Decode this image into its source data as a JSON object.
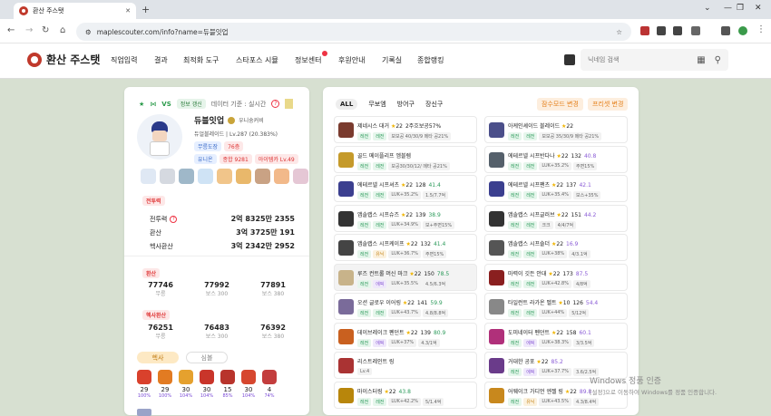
{
  "browser": {
    "tab_title": "환산 주스탯",
    "url": "maplescouter.com/info?name=듀블잇업"
  },
  "site": {
    "logo": "환산 주스탯",
    "menu": [
      "직업입력",
      "결과",
      "최적화 도구",
      "스타포스 시뮬",
      "정보센터",
      "후원안내",
      "기록실",
      "종합랭킹"
    ],
    "search_placeholder": "닉네임 검색"
  },
  "profile": {
    "vs": "VS",
    "update_btn": "정보 갱신",
    "data_basis": "데이터 기준 : 실시간",
    "name": "듀블잇업",
    "guild": "우니숭커비",
    "job_line": "듀얼블레이드 | Lv.287 (20.383%)",
    "tags1": [
      "무릉도장",
      "76층"
    ],
    "tags2": [
      "유니온",
      "종합 9281",
      "아이템카 Lv.49"
    ]
  },
  "combat": {
    "header": "전투력",
    "rows": [
      {
        "label": "전투력",
        "value": "2억 8325만 2355"
      },
      {
        "label": "환산",
        "value": "3억 3725만 191"
      },
      {
        "label": "헥사환산",
        "value": "3억 2342만 2952"
      }
    ]
  },
  "hwansan": {
    "header": "환산",
    "cols": [
      {
        "v": "77746",
        "l": "무릉"
      },
      {
        "v": "77992",
        "l": "보스 300"
      },
      {
        "v": "77891",
        "l": "보스 380"
      }
    ]
  },
  "hexa": {
    "header": "헥사환산",
    "cols": [
      {
        "v": "76251",
        "l": "무릉"
      },
      {
        "v": "76483",
        "l": "보스 300"
      },
      {
        "v": "76392",
        "l": "보스 380"
      }
    ]
  },
  "skill_tabs": [
    "헥사",
    "심볼"
  ],
  "hexa_skills": [
    {
      "lv": "29",
      "pct": "100%"
    },
    {
      "lv": "29",
      "pct": "100%"
    },
    {
      "lv": "30",
      "pct": "104%"
    },
    {
      "lv": "30",
      "pct": "104%"
    },
    {
      "lv": "15",
      "pct": "85%"
    },
    {
      "lv": "30",
      "pct": "104%"
    },
    {
      "lv": "4",
      "pct": "74%"
    }
  ],
  "equip": {
    "tabs": [
      "ALL",
      "무보엠",
      "방어구",
      "장신구"
    ],
    "btn_potential": "잠수모드 변경",
    "btn_preset": "프리셋 변경",
    "items": [
      {
        "name": "제네시스 대거",
        "star": "22",
        "extra": "2주흐보공57%",
        "subs": [
          "레전",
          "레전",
          "보보공 40/30/9 메타 공21%"
        ],
        "color": "#7a3b2e"
      },
      {
        "name": "아케인셰이드 블레이드",
        "star": "22",
        "extra": "",
        "subs": [
          "레전",
          "레전",
          "보보공 35/30/9 메타 공21%"
        ],
        "color": "#4b4f8a"
      },
      {
        "name": "골드 메이플리프 엠블렘",
        "star": "",
        "extra": "",
        "subs": [
          "레전",
          "레전",
          "보공30/30/12/ 메타 공21%"
        ],
        "color": "#c59a2a"
      },
      {
        "name": "에테르넬 시프반다나",
        "star": "22",
        "extra": "132",
        "num": "40.8",
        "subs": [
          "레전",
          "레전",
          "LUK+35.2%",
          "주면15%"
        ],
        "color": "#55606b"
      },
      {
        "name": "에테르넬 시프셔츠",
        "star": "22",
        "extra": "128",
        "num": "41.4",
        "subs": [
          "레전",
          "레전",
          "LUK+35.2%",
          "1.5/7.7억"
        ],
        "color": "#3b3f8f"
      },
      {
        "name": "에테르넬 시프팬츠",
        "star": "22",
        "extra": "137",
        "num": "42.1",
        "subs": [
          "레전",
          "레전",
          "LUK+35.4%",
          "보스+35%"
        ],
        "color": "#3b3f8f"
      },
      {
        "name": "앱솔랩스 시프슈즈",
        "star": "22",
        "extra": "139",
        "num": "38.9",
        "subs": [
          "레전",
          "레전",
          "LUK+34.9%",
          "보+주면15%"
        ],
        "color": "#333"
      },
      {
        "name": "앱솔랩스 시프글러브",
        "star": "22",
        "extra": "151",
        "num": "44.2",
        "subs": [
          "레전",
          "레전",
          "크크",
          "4/4/7억"
        ],
        "color": "#333"
      },
      {
        "name": "앱솔랩스 시프케이프",
        "star": "22",
        "extra": "132",
        "num": "41.4",
        "subs": [
          "레전",
          "유닉",
          "LUK+36.7%",
          "주면15%"
        ],
        "color": "#444"
      },
      {
        "name": "앱솔랩스 시프숄더",
        "star": "22",
        "extra": "",
        "num": "16.9",
        "subs": [
          "레전",
          "레전",
          "LUK+38%",
          "4/3.1억"
        ],
        "color": "#555"
      },
      {
        "name": "루즈 컨트롤 머신 마크",
        "star": "22",
        "extra": "150",
        "num": "78.5",
        "subs": [
          "레전",
          "에픽",
          "LUK+35.5%",
          "4.5/6.3억"
        ],
        "color": "#c8b38a"
      },
      {
        "name": "마력이 깃든 안대",
        "star": "22",
        "extra": "173",
        "num": "87.5",
        "subs": [
          "레전",
          "레전",
          "LUK+42.8%",
          "4/8억"
        ],
        "color": "#8a1f1f"
      },
      {
        "name": "오션 글로우 이어링",
        "star": "22",
        "extra": "141",
        "num": "59.9",
        "subs": [
          "레전",
          "레전",
          "LUK+43.7%",
          "4.8/8.8억"
        ],
        "color": "#7a6b9a"
      },
      {
        "name": "타일런트 라가온 벨트",
        "star": "10",
        "extra": "126",
        "num": "54.4",
        "subs": [
          "레전",
          "레전",
          "LUK+44%",
          "5/12억"
        ],
        "color": "#888"
      },
      {
        "name": "데이브레이크 펜던트",
        "star": "22",
        "extra": "139",
        "num": "80.9",
        "subs": [
          "레전",
          "에픽",
          "LUK+37%",
          "4.3/1억"
        ],
        "color": "#c9601f"
      },
      {
        "name": "도미네이터 펜던트",
        "star": "22",
        "extra": "158",
        "num": "60.1",
        "subs": [
          "레전",
          "에픽",
          "LUK+38.3%",
          "3/3.5억"
        ],
        "color": "#b0307a"
      },
      {
        "name": "리스트레인트 링",
        "star": "",
        "extra": "",
        "num": "",
        "subs": [
          "Lv.4"
        ],
        "color": "#a33"
      },
      {
        "name": "거대한 공포",
        "star": "22",
        "extra": "",
        "num": "85.2",
        "subs": [
          "레전",
          "에픽",
          "LUK+37.7%",
          "3.6/2.5억"
        ],
        "color": "#6a3b8a"
      },
      {
        "name": "마이스터링",
        "star": "22",
        "extra": "",
        "num": "43.8",
        "subs": [
          "레전",
          "레전",
          "LUK+42.2%",
          "5/1.4억"
        ],
        "color": "#b8860b"
      },
      {
        "name": "어웨이크 가디언 엔젤 링",
        "star": "22",
        "extra": "",
        "num": "89.8",
        "subs": [
          "레전",
          "유닉",
          "LUK+43.5%",
          "4.3/8.4억"
        ],
        "color": "#c8881d"
      }
    ]
  },
  "watermark": {
    "l1": "Windows 정품 인증",
    "l2": "[설정]으로 이동하여 Windows를 정품 인증합니다."
  }
}
